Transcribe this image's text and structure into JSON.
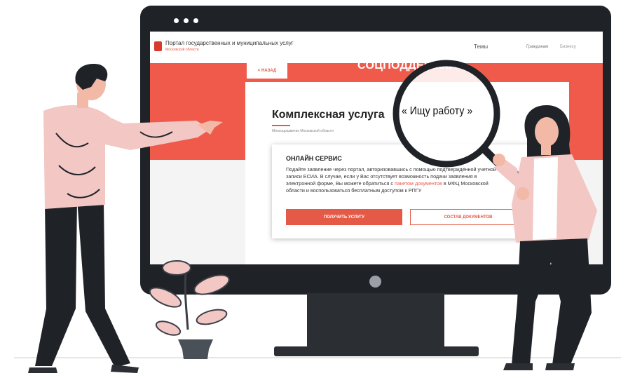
{
  "portal": {
    "title": "Портал государственных и муниципальных услуг",
    "subtitle": "Московской области",
    "nav": {
      "themes": "Темы",
      "citizens": "Гражданам",
      "business": "Бизнесу"
    }
  },
  "band": {
    "title": "СОЦПОДДЕРЖКА",
    "back_label": "< НАЗАД"
  },
  "service": {
    "title": "Комплексная услуга",
    "search_phrase": "« Ищу работу »",
    "ministry": "Минсоцразвития Московской области"
  },
  "online": {
    "title": "ОНЛАЙН СЕРВИС",
    "text_before_link": "Подайте заявление через портал, авторизовавшись с помощью подтверждённой учетной записи ЕСИА. В случае, если у Вас отсутствует возможность подачи заявления в электронной форме, Вы можете обратиться с ",
    "link": "пакетом документов",
    "text_after_link": " в МФЦ Московской области и воспользоваться бесплатным доступом к РПГУ",
    "btn_get": "ПОЛУЧИТЬ УСЛУГУ",
    "btn_docs": "СОСТАВ ДОКУМЕНТОВ"
  },
  "colors": {
    "accent": "#ef5a4b",
    "dark": "#1f2328",
    "blouse": "#f2c7c4"
  },
  "icons": {
    "back": "chevron-left-icon",
    "logo": "coat-of-arms-icon",
    "magnifier": "magnifier-icon"
  }
}
